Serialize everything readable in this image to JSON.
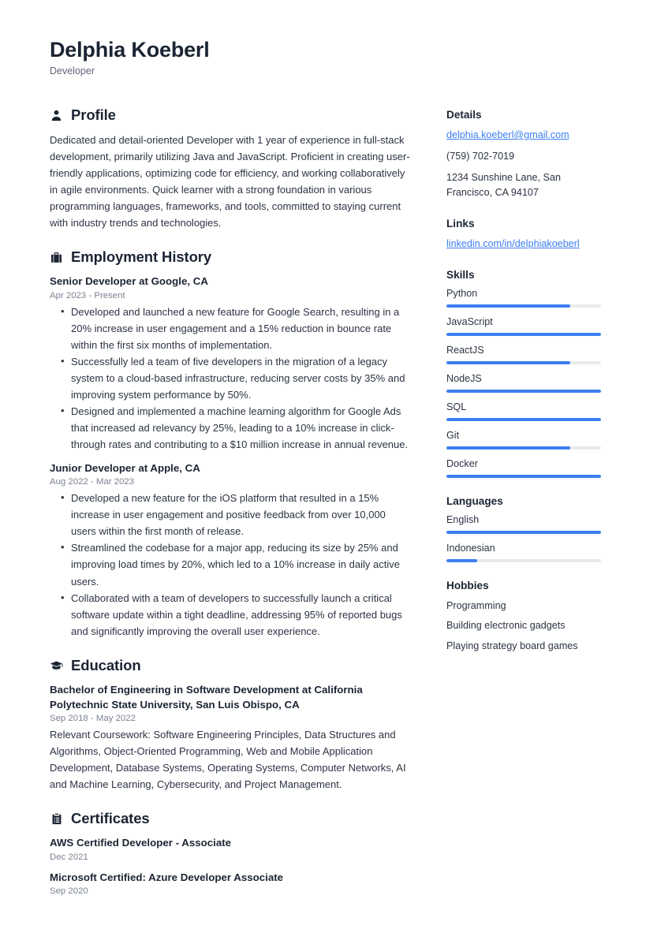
{
  "header": {
    "name": "Delphia Koeberl",
    "title": "Developer"
  },
  "colors": {
    "accent": "#3c7ef0",
    "text": "#1b2433",
    "muted": "#7b8291",
    "track": "#e8eaed"
  },
  "main": {
    "profile": {
      "heading": "Profile",
      "icon": "person-icon",
      "text": "Dedicated and detail-oriented Developer with 1 year of experience in full-stack development, primarily utilizing Java and JavaScript. Proficient in creating user-friendly applications, optimizing code for efficiency, and working collaboratively in agile environments. Quick learner with a strong foundation in various programming languages, frameworks, and tools, committed to staying current with industry trends and technologies."
    },
    "employment": {
      "heading": "Employment History",
      "icon": "briefcase-icon",
      "entries": [
        {
          "title": "Senior Developer at Google, CA",
          "date": "Apr 2023 - Present",
          "bullets": [
            "Developed and launched a new feature for Google Search, resulting in a 20% increase in user engagement and a 15% reduction in bounce rate within the first six months of implementation.",
            "Successfully led a team of five developers in the migration of a legacy system to a cloud-based infrastructure, reducing server costs by 35% and improving system performance by 50%.",
            "Designed and implemented a machine learning algorithm for Google Ads that increased ad relevancy by 25%, leading to a 10% increase in click-through rates and contributing to a $10 million increase in annual revenue."
          ]
        },
        {
          "title": "Junior Developer at Apple, CA",
          "date": "Aug 2022 - Mar 2023",
          "bullets": [
            "Developed a new feature for the iOS platform that resulted in a 15% increase in user engagement and positive feedback from over 10,000 users within the first month of release.",
            "Streamlined the codebase for a major app, reducing its size by 25% and improving load times by 20%, which led to a 10% increase in daily active users.",
            "Collaborated with a team of developers to successfully launch a critical software update within a tight deadline, addressing 95% of reported bugs and significantly improving the overall user experience."
          ]
        }
      ]
    },
    "education": {
      "heading": "Education",
      "icon": "graduation-cap-icon",
      "entries": [
        {
          "title": "Bachelor of Engineering in Software Development at California Polytechnic State University, San Luis Obispo, CA",
          "date": "Sep 2018 - May 2022",
          "desc": "Relevant Coursework: Software Engineering Principles, Data Structures and Algorithms, Object-Oriented Programming, Web and Mobile Application Development, Database Systems, Operating Systems, Computer Networks, AI and Machine Learning, Cybersecurity, and Project Management."
        }
      ]
    },
    "certificates": {
      "heading": "Certificates",
      "icon": "clipboard-icon",
      "entries": [
        {
          "title": "AWS Certified Developer - Associate",
          "date": "Dec 2021"
        },
        {
          "title": "Microsoft Certified: Azure Developer Associate",
          "date": "Sep 2020"
        }
      ]
    }
  },
  "sidebar": {
    "details": {
      "heading": "Details",
      "email": "delphia.koeberl@gmail.com",
      "phone": "(759) 702-7019",
      "address": "1234 Sunshine Lane, San Francisco, CA 94107"
    },
    "links": {
      "heading": "Links",
      "items": [
        {
          "label": "linkedin.com/in/delphiakoeberl"
        }
      ]
    },
    "skills": {
      "heading": "Skills",
      "items": [
        {
          "name": "Python",
          "level": 80
        },
        {
          "name": "JavaScript",
          "level": 100
        },
        {
          "name": "ReactJS",
          "level": 80
        },
        {
          "name": "NodeJS",
          "level": 100
        },
        {
          "name": "SQL",
          "level": 100
        },
        {
          "name": "Git",
          "level": 80
        },
        {
          "name": "Docker",
          "level": 100
        }
      ]
    },
    "languages": {
      "heading": "Languages",
      "items": [
        {
          "name": "English",
          "level": 100
        },
        {
          "name": "Indonesian",
          "level": 20
        }
      ]
    },
    "hobbies": {
      "heading": "Hobbies",
      "items": [
        {
          "label": "Programming"
        },
        {
          "label": "Building electronic gadgets"
        },
        {
          "label": "Playing strategy board games"
        }
      ]
    }
  }
}
